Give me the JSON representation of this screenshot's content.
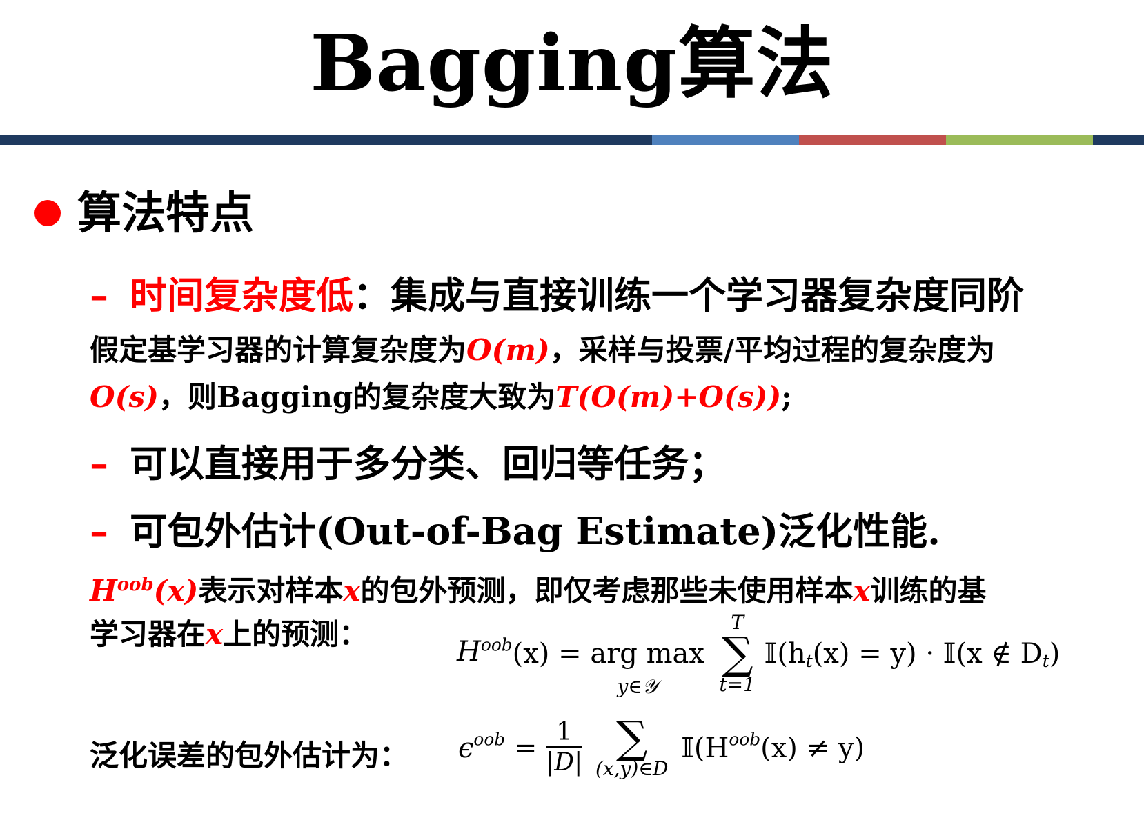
{
  "title": "Bagging算法",
  "bar_colors": [
    "#1f3a5f",
    "#4f81bd",
    "#c0504d",
    "#9bbb59",
    "#1f3a5f"
  ],
  "section": {
    "heading": "算法特点"
  },
  "items": [
    {
      "dash": "–",
      "highlight": "时间复杂度低",
      "rest": "：集成与直接训练一个学习器复杂度同阶"
    },
    {
      "dash": "–",
      "text": "可以直接用于多分类、回归等任务；"
    },
    {
      "dash": "–",
      "text": "可包外估计(Out-of-Bag Estimate)泛化性能."
    }
  ],
  "para1": {
    "a": "假定基学习器的计算复杂度为",
    "om": "O(m)",
    "b": "，采样与投票/平均过程的复杂度为",
    "os": "O(s)",
    "c": "，则Bagging的复杂度大致为",
    "t": "T(O(m)+O(s))",
    "d": ";"
  },
  "para2": {
    "h": "H",
    "oob": "oob",
    "hx": "(x)",
    "a": "表示对样本",
    "x1": "x",
    "b": "的包外预测，即仅考虑那些未使用样本",
    "x2": "x",
    "c": "训练的基",
    "line2a": "学习器在",
    "x3": "x",
    "line2b": "上的预测："
  },
  "formula1": {
    "lhs_h": "H",
    "lhs_sup": "oob",
    "lhs_arg": "(x) = arg max",
    "under": "y∈𝒴",
    "sum_top": "T",
    "sum": "∑",
    "sum_bot": "t=1",
    "rhs": "𝕀(h",
    "rhs_sub": "t",
    "rhs2": "(x) = y) · 𝕀(x ∉ D",
    "rhs_sub2": "t",
    "rhs3": ")"
  },
  "para3": {
    "text": "泛化误差的包外估计为："
  },
  "formula2": {
    "eps": "ϵ",
    "eps_sup": "oob",
    "eq": "=",
    "num": "1",
    "den": "|D|",
    "sum": "∑",
    "sum_bot": "(x,y)∈D",
    "rhs": "𝕀(H",
    "rhs_sup": "oob",
    "rhs2": "(x) ≠ y)"
  }
}
